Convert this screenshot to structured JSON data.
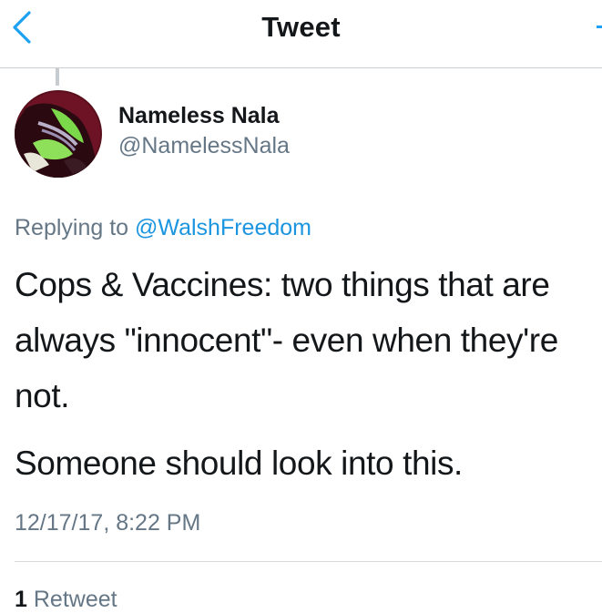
{
  "header": {
    "title": "Tweet",
    "back_icon": "chevron-left-icon",
    "accent_color": "#1da1f2"
  },
  "tweet": {
    "author_name": "Nameless Nala",
    "author_handle": "@NamelessNala",
    "replying_prefix": "Replying to",
    "replying_to": "@WalshFreedom",
    "text_lines": [
      "Cops & Vaccines: two things that are always \"innocent\"- even when they're not.",
      "Someone should look into this."
    ],
    "timestamp": "12/17/17, 8:22 PM",
    "retweet_count": "1",
    "retweet_label": "Retweet"
  }
}
